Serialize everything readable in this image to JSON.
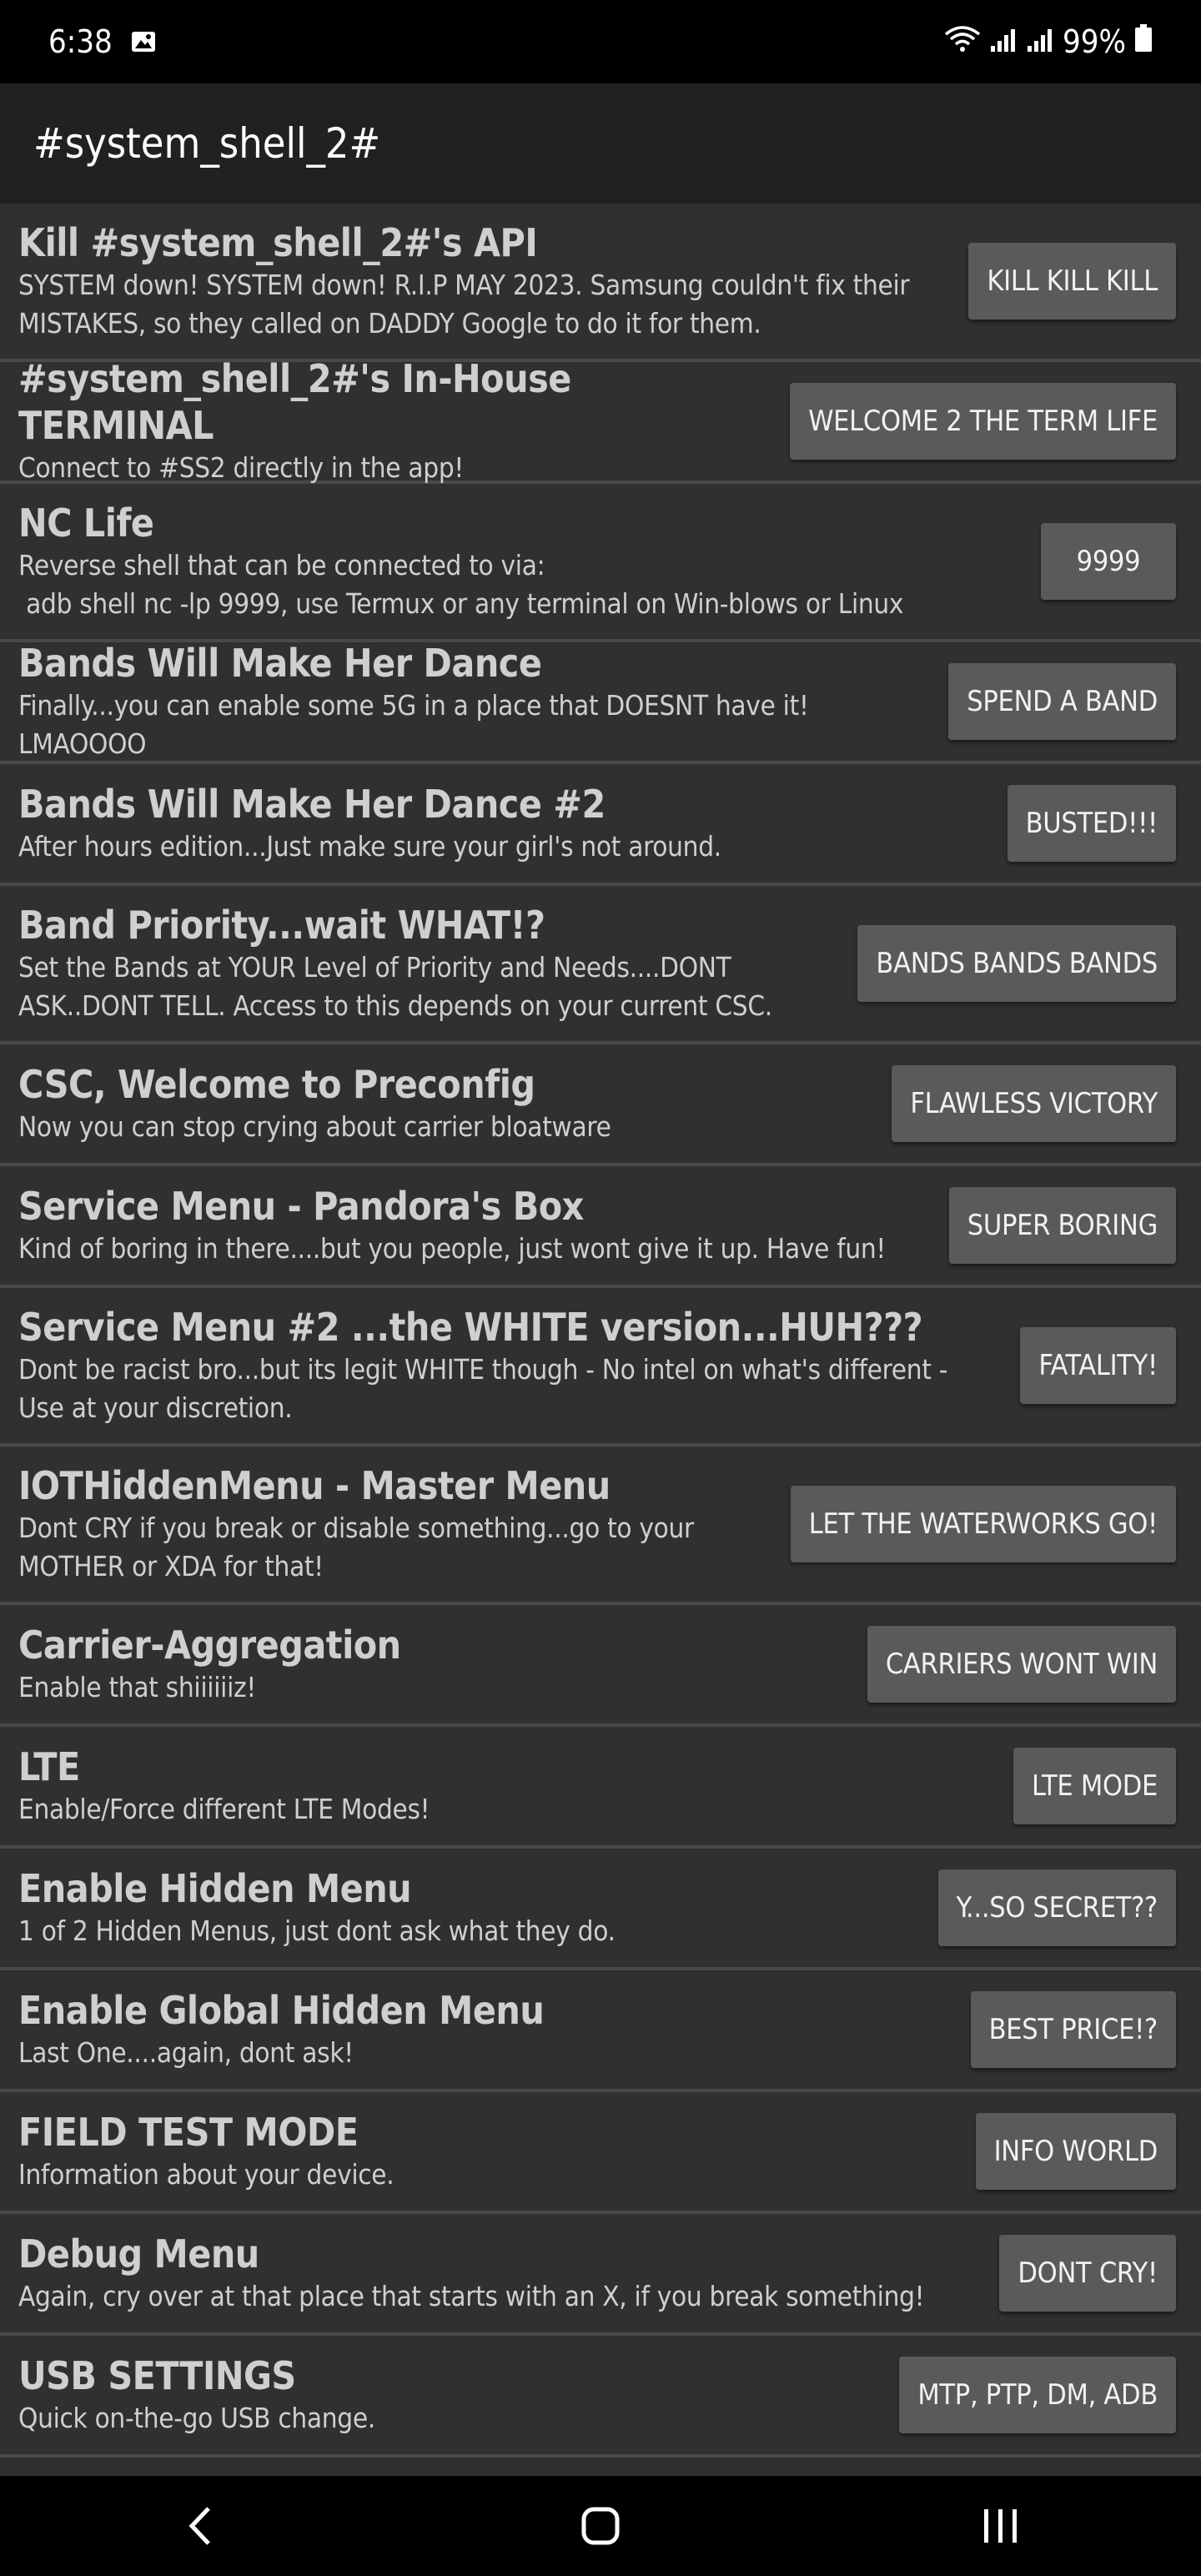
{
  "status_bar": {
    "time": "6:38",
    "battery": "99%",
    "icons": [
      "image-icon",
      "wifi-icon",
      "signal-icon",
      "signal-icon",
      "battery-icon"
    ]
  },
  "app_bar": {
    "title": "#system_shell_2#"
  },
  "items": [
    {
      "title": "Kill #system_shell_2#'s API",
      "description": "SYSTEM down! SYSTEM down! R.I.P MAY 2023. Samsung couldn't fix their MISTAKES, so they called on DADDY Google to do it for them.",
      "button": "KILL KILL KILL"
    },
    {
      "title": "#system_shell_2#'s In-House TERMINAL",
      "description": "Connect to #SS2 directly in the app!",
      "button": "WELCOME 2 THE TERM LIFE"
    },
    {
      "title": "NC Life",
      "description": "Reverse shell that can be connected to via:\n adb shell nc -lp 9999, use Termux or any terminal on Win-blows or Linux",
      "button": "9999"
    },
    {
      "title": "Bands Will Make Her Dance",
      "description": "Finally...you can enable some 5G in a place that DOESNT have it! LMAOOOO",
      "button": "SPEND A BAND"
    },
    {
      "title": "Bands Will Make Her Dance #2",
      "description": "After hours edition...Just make sure your girl's not around.",
      "button": "BUSTED!!!"
    },
    {
      "title": "Band Priority...wait WHAT!?",
      "description": "Set the Bands at YOUR Level of Priority and Needs....DONT ASK..DONT TELL. Access to this depends on your current CSC.",
      "button": "BANDS BANDS BANDS"
    },
    {
      "title": "CSC, Welcome to Preconfig",
      "description": "Now you can stop crying about carrier bloatware",
      "button": "FLAWLESS VICTORY"
    },
    {
      "title": "Service Menu - Pandora's Box",
      "description": "Kind of boring in there....but you people, just wont give it up. Have fun!",
      "button": "SUPER BORING"
    },
    {
      "title": "Service Menu #2 ...the WHITE version...HUH???",
      "description": "Dont be racist bro...but its legit WHITE though - No intel on what's different - Use at your discretion.",
      "button": "FATALITY!"
    },
    {
      "title": "IOTHiddenMenu - Master Menu",
      "description": "Dont CRY if you break or disable something...go to your MOTHER or XDA for that!",
      "button": "LET THE WATERWORKS GO!"
    },
    {
      "title": "Carrier-Aggregation",
      "description": "Enable that shiiiiiiz!",
      "button": "CARRIERS WONT WIN"
    },
    {
      "title": "LTE",
      "description": "Enable/Force different LTE Modes!",
      "button": "LTE MODE"
    },
    {
      "title": "Enable Hidden Menu",
      "description": "1 of 2 Hidden Menus, just dont ask what they do.",
      "button": "Y...SO SECRET??"
    },
    {
      "title": "Enable Global Hidden Menu",
      "description": "Last One....again, dont ask!",
      "button": "BEST PRICE!?"
    },
    {
      "title": "FIELD TEST MODE",
      "description": "Information about your device.",
      "button": "INFO WORLD"
    },
    {
      "title": "Debug Menu",
      "description": "Again, cry over at that place that starts with an X, if you break something!",
      "button": "DONT CRY!"
    },
    {
      "title": "USB SETTINGS",
      "description": "Quick on-the-go USB change.",
      "button": "MTP, PTP, DM, ADB"
    }
  ],
  "nav_bar": {
    "icons": [
      "back-icon",
      "home-icon",
      "recents-icon"
    ]
  }
}
